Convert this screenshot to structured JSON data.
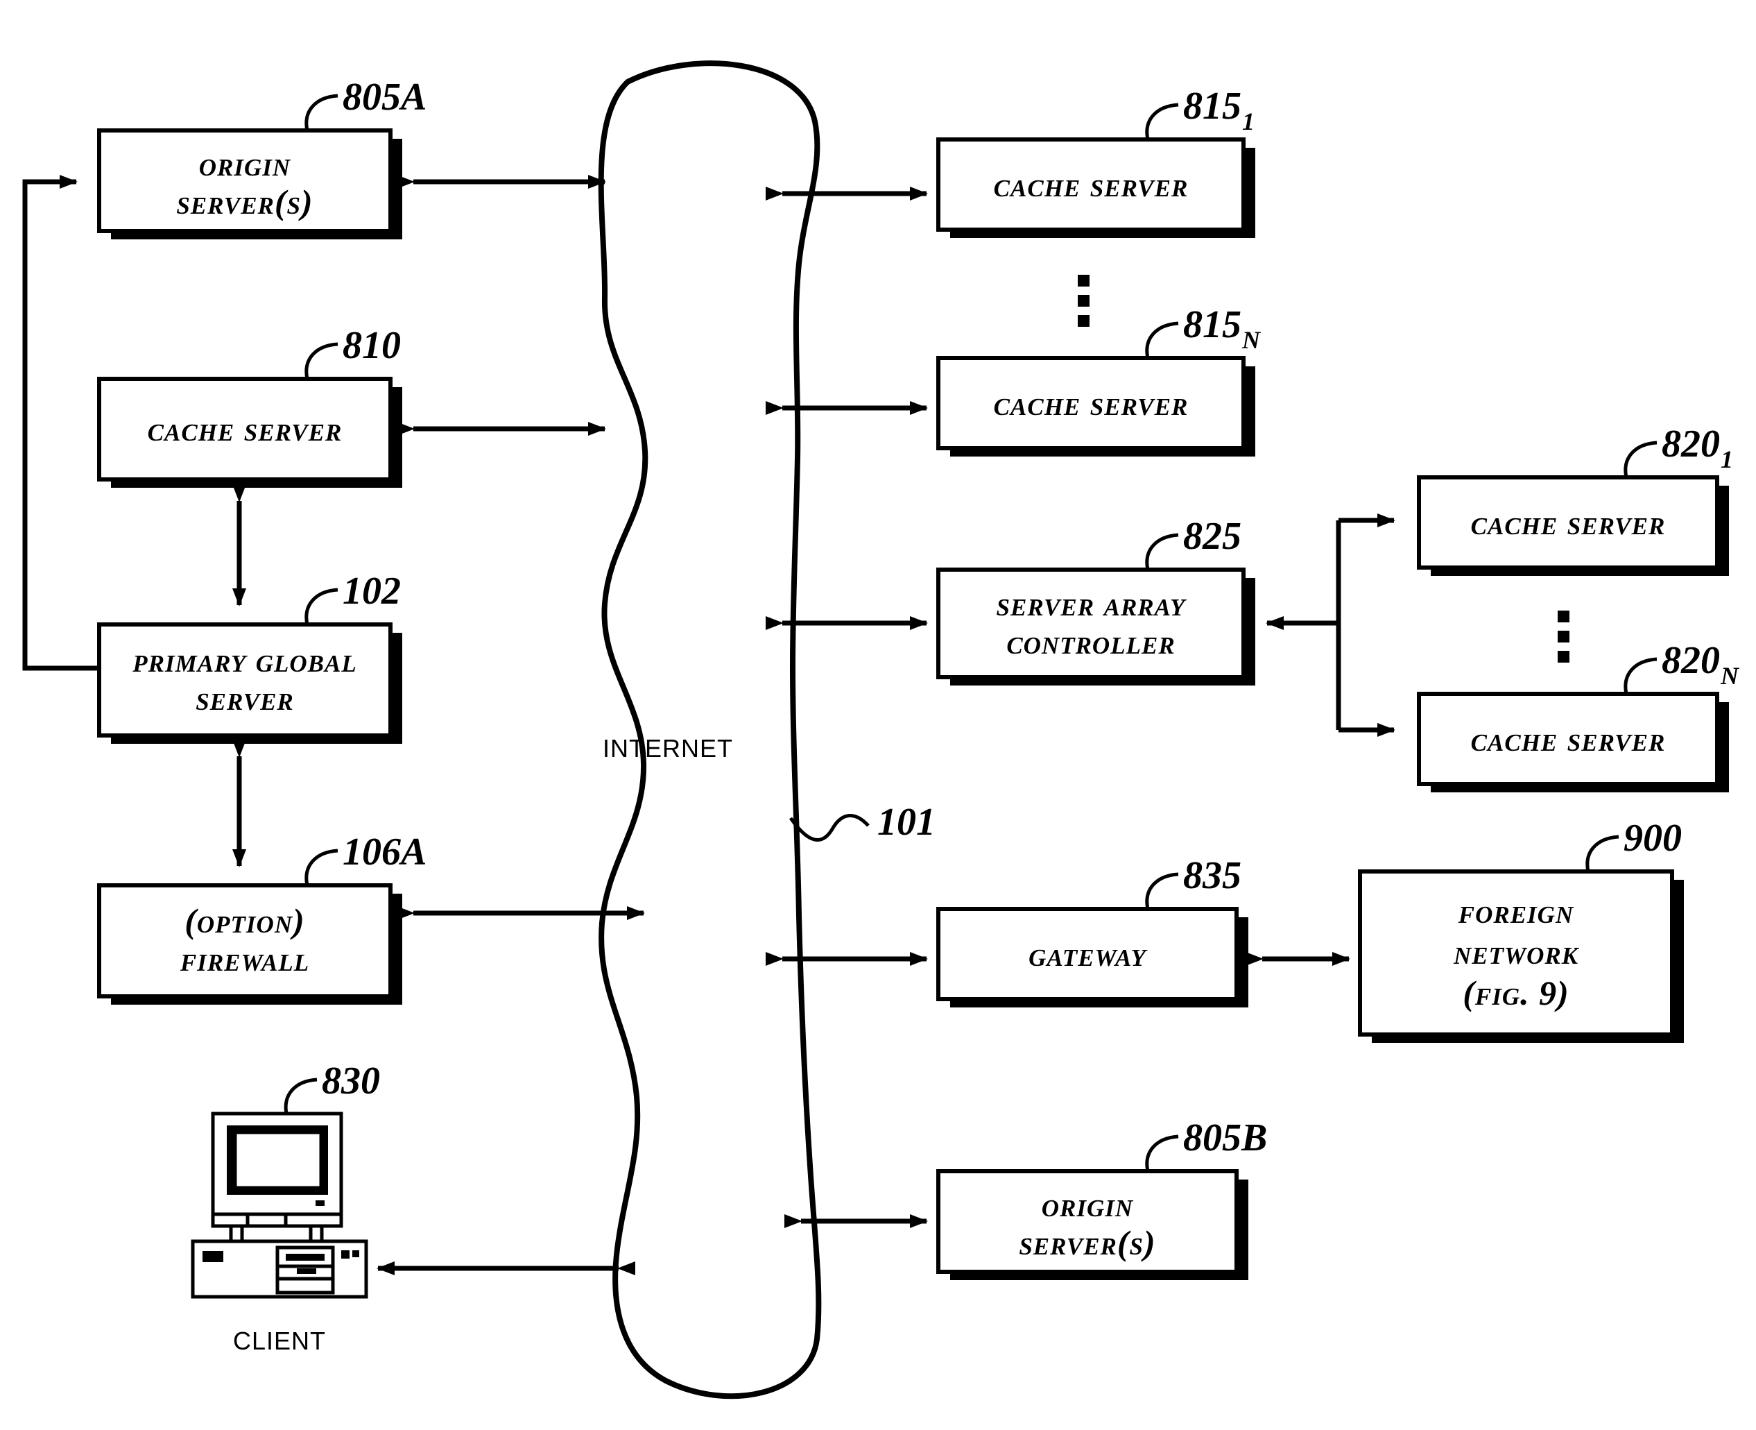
{
  "figure": {
    "title": "Network diagram with Internet cloud, origin servers, cache servers, global server, firewall, gateway and client",
    "cloud_label": "Internet",
    "cloud_ref": "101",
    "client_label": "Client"
  },
  "nodes": {
    "origin_server_a": {
      "line1": "Origin",
      "line2": "Server(s)",
      "ref": "805A",
      "ref_sub": ""
    },
    "cache_server_810": {
      "line1": "Cache Server",
      "line2": "",
      "ref": "810",
      "ref_sub": ""
    },
    "primary_global_server": {
      "line1": "Primary Global",
      "line2": "Server",
      "ref": "102",
      "ref_sub": ""
    },
    "option_firewall": {
      "line1": "(Option)",
      "line2": "Firewall",
      "ref": "106A",
      "ref_sub": ""
    },
    "client": {
      "line1": "Client",
      "ref": "830",
      "ref_sub": ""
    },
    "cache_server_815_1": {
      "line1": "Cache Server",
      "line2": "",
      "ref": "815",
      "ref_sub": "1"
    },
    "cache_server_815_n": {
      "line1": "Cache Server",
      "line2": "",
      "ref": "815",
      "ref_sub": "N"
    },
    "server_array_controller": {
      "line1": "Server Array",
      "line2": "Controller",
      "ref": "825",
      "ref_sub": ""
    },
    "cache_server_820_1": {
      "line1": "Cache Server",
      "line2": "",
      "ref": "820",
      "ref_sub": "1"
    },
    "cache_server_820_n": {
      "line1": "Cache Server",
      "line2": "",
      "ref": "820",
      "ref_sub": "N"
    },
    "gateway": {
      "line1": "Gateway",
      "line2": "",
      "ref": "835",
      "ref_sub": ""
    },
    "foreign_network": {
      "line1": "Foreign",
      "line2": "Network",
      "line3": "(Fig. 9)",
      "ref": "900",
      "ref_sub": ""
    },
    "origin_server_b": {
      "line1": "Origin",
      "line2": "Server(s)",
      "ref": "805B",
      "ref_sub": ""
    }
  },
  "colors": {
    "ink": "#000000",
    "paper": "#ffffff"
  }
}
